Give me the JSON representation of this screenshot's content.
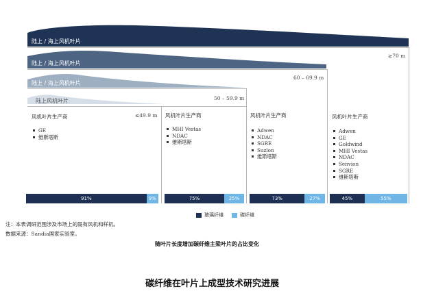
{
  "blades": [
    {
      "label": "陆上 / 海上风机叶片"
    },
    {
      "label": "陆上 / 海上风机叶片"
    },
    {
      "label": "陆上 / 海上风机叶片"
    },
    {
      "label": "陆上风机叶片"
    }
  ],
  "groups": [
    {
      "title": "风机叶片生产商",
      "range": "≤49.9 m",
      "manufacturers": [
        "GE",
        "维斯塔斯"
      ],
      "glass_fiber_pct": "91%",
      "carbon_fiber_pct": "9%",
      "glass_value": 91,
      "carbon_value": 9
    },
    {
      "title": "风机叶片生产商",
      "range": "50 – 59.9 m",
      "manufacturers": [
        "MHI Vestas",
        "NDAC",
        "维斯塔斯"
      ],
      "glass_fiber_pct": "75%",
      "carbon_fiber_pct": "25%",
      "glass_value": 75,
      "carbon_value": 25
    },
    {
      "title": "风机叶片生产商",
      "range": "60 – 69.9 m",
      "manufacturers": [
        "Adwen",
        "NDAC",
        "SGRE",
        "Suzlon",
        "维斯塔斯"
      ],
      "glass_fiber_pct": "73%",
      "carbon_fiber_pct": "27%",
      "glass_value": 73,
      "carbon_value": 27
    },
    {
      "title": "风机叶片生产商",
      "range": "≥70 m",
      "manufacturers": [
        "Adwen",
        "GE",
        "Goldwind",
        "MHI Vestas",
        "NDAC",
        "Senvion",
        "SGRE",
        "维斯塔斯"
      ],
      "glass_fiber_pct": "45%",
      "carbon_fiber_pct": "55%",
      "glass_value": 45,
      "carbon_value": 55
    }
  ],
  "legend": {
    "glass": "玻璃纤维",
    "carbon": "碳纤维"
  },
  "colors": {
    "glass": "#1d2f52",
    "carbon": "#6fb6e6"
  },
  "notes": [
    "注：本表调研范围涉及市场上的既有风机和样机。",
    "数据来源：Sandia国家实验室。"
  ],
  "figure_caption": "随叶片长度增加碳纤维主梁叶片的占比变化",
  "page_title": "碳纤维在叶片上成型技术研究进展"
}
